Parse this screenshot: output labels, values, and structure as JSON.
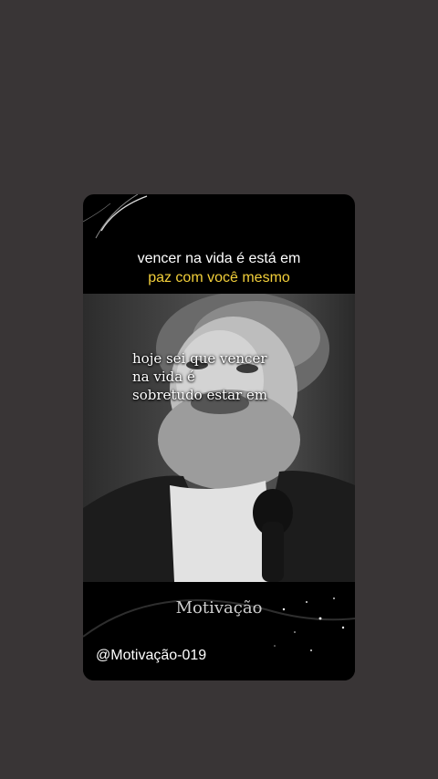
{
  "video": {
    "caption_line1": "vencer na vida é está em",
    "caption_line2": "paz com você mesmo",
    "overlay_lines": [
      "hoje sei que vencer",
      "na vida é",
      "sobretudo estar em"
    ],
    "sub_label": "Motivação",
    "handle": "@Motivação-019"
  },
  "colors": {
    "page_background": "#393536",
    "card_background": "#000000",
    "caption_highlight": "#f2cf3a"
  }
}
